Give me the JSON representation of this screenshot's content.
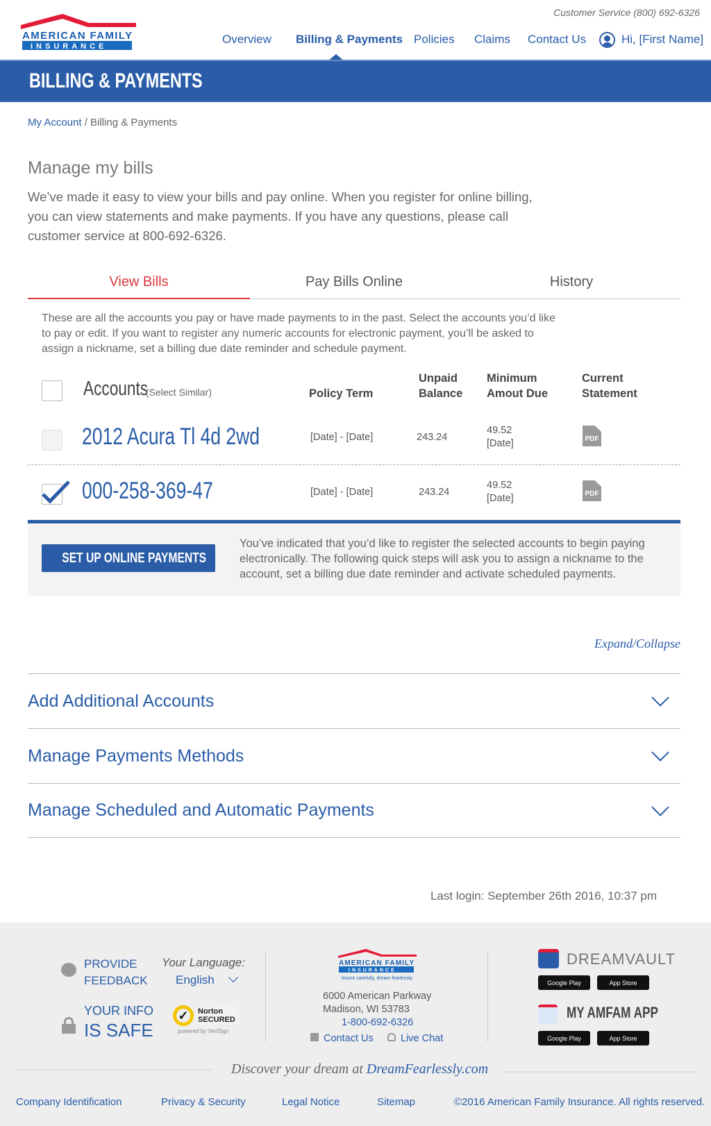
{
  "header": {
    "customer_service": "Customer Service (800) 692-6326",
    "logo_text": "AMERICAN FAMILY INSURANCE",
    "nav": [
      "Overview",
      "Billing & Payments",
      "Policies",
      "Claims",
      "Contact Us"
    ],
    "greeting": "Hi, [First Name]",
    "active_nav": "Billing & Payments"
  },
  "banner": {
    "title": "BILLING & PAYMENTS"
  },
  "breadcrumb": {
    "link": "My Account",
    "current": " / Billing & Payments"
  },
  "main": {
    "title": "Manage my bills",
    "intro": "We’ve made it easy to view your bills and pay online. When you register for online billing, you can view statements and make payments. If you have any questions, please call customer service at 800-692-6326.",
    "tabs": [
      "View Bills",
      "Pay Bills Online",
      "History"
    ],
    "description": "These are all the accounts you pay or have made payments to in the past. Select the accounts you’d like to pay or edit. If you want to register any numeric accounts for electronic payment, you’ll be asked to assign a nickname, set a billing due date reminder and schedule payment.",
    "table": {
      "headers": {
        "accounts": "Accounts",
        "select_similar": "(Select Similar)",
        "policy_term": "Policy Term",
        "unpaid_balance": "Unpaid Balance",
        "minimum_due": "Minimum Amout Due",
        "current_statement": "Current Statement"
      },
      "rows": [
        {
          "name": "2012 Acura Tl 4d 2wd",
          "term": "[Date] - [Date]",
          "balance": "243.24",
          "min_amount": "49.52",
          "min_date": "[Date]",
          "statement": "PDF",
          "checked": false
        },
        {
          "name": "000-258-369-47",
          "term": "[Date] - [Date]",
          "balance": "243.24",
          "min_amount": "49.52",
          "min_date": "[Date]",
          "statement": "PDF",
          "checked": true
        }
      ]
    },
    "setup_button": "SET UP ONLINE PAYMENTS",
    "setup_text": "You’ve indicated that you’d like to register the selected accounts to begin paying electronically. The following quick steps will ask you to assign a nickname to the account, set a billing due date reminder and activate scheduled payments.",
    "expand_collapse": "Expand/Collapse",
    "accordions": [
      "Add Additional Accounts",
      "Manage Payments Methods",
      "Manage Scheduled and Automatic Payments"
    ],
    "last_login": "Last login: September 26th 2016, 10:37 pm"
  },
  "footer": {
    "feedback": [
      "PROVIDE",
      "FEEDBACK"
    ],
    "language_label": "Your Language:",
    "language": "English",
    "info": [
      "YOUR INFO",
      "IS SAFE"
    ],
    "norton": "Norton SECURED",
    "norton_sub": "powered by VeriSign",
    "logo_tagline": "Insure carefully, dream fearlessly.",
    "address1": "6000 American Parkway",
    "address2": "Madison, WI 53783",
    "phone": "1-800-692-6326",
    "contact": "Contact Us",
    "chat": "Live Chat",
    "dreamvault": "DREAMVAULT",
    "amfam_app": "MY AMFAM APP",
    "google_play": "Google Play",
    "app_store": "App Store",
    "discover": "Discover your dream at ",
    "discover_link": "DreamFearlessly.com",
    "links": [
      "Company Identification",
      "Privacy & Security",
      "Legal Notice",
      "Sitemap"
    ],
    "copyright": "©2016 American Family Insurance. All rights reserved."
  },
  "colors": {
    "brand_blue": "#2a5ca8",
    "brand_red": "#d9373c",
    "footer_bg": "#eeeeee"
  }
}
